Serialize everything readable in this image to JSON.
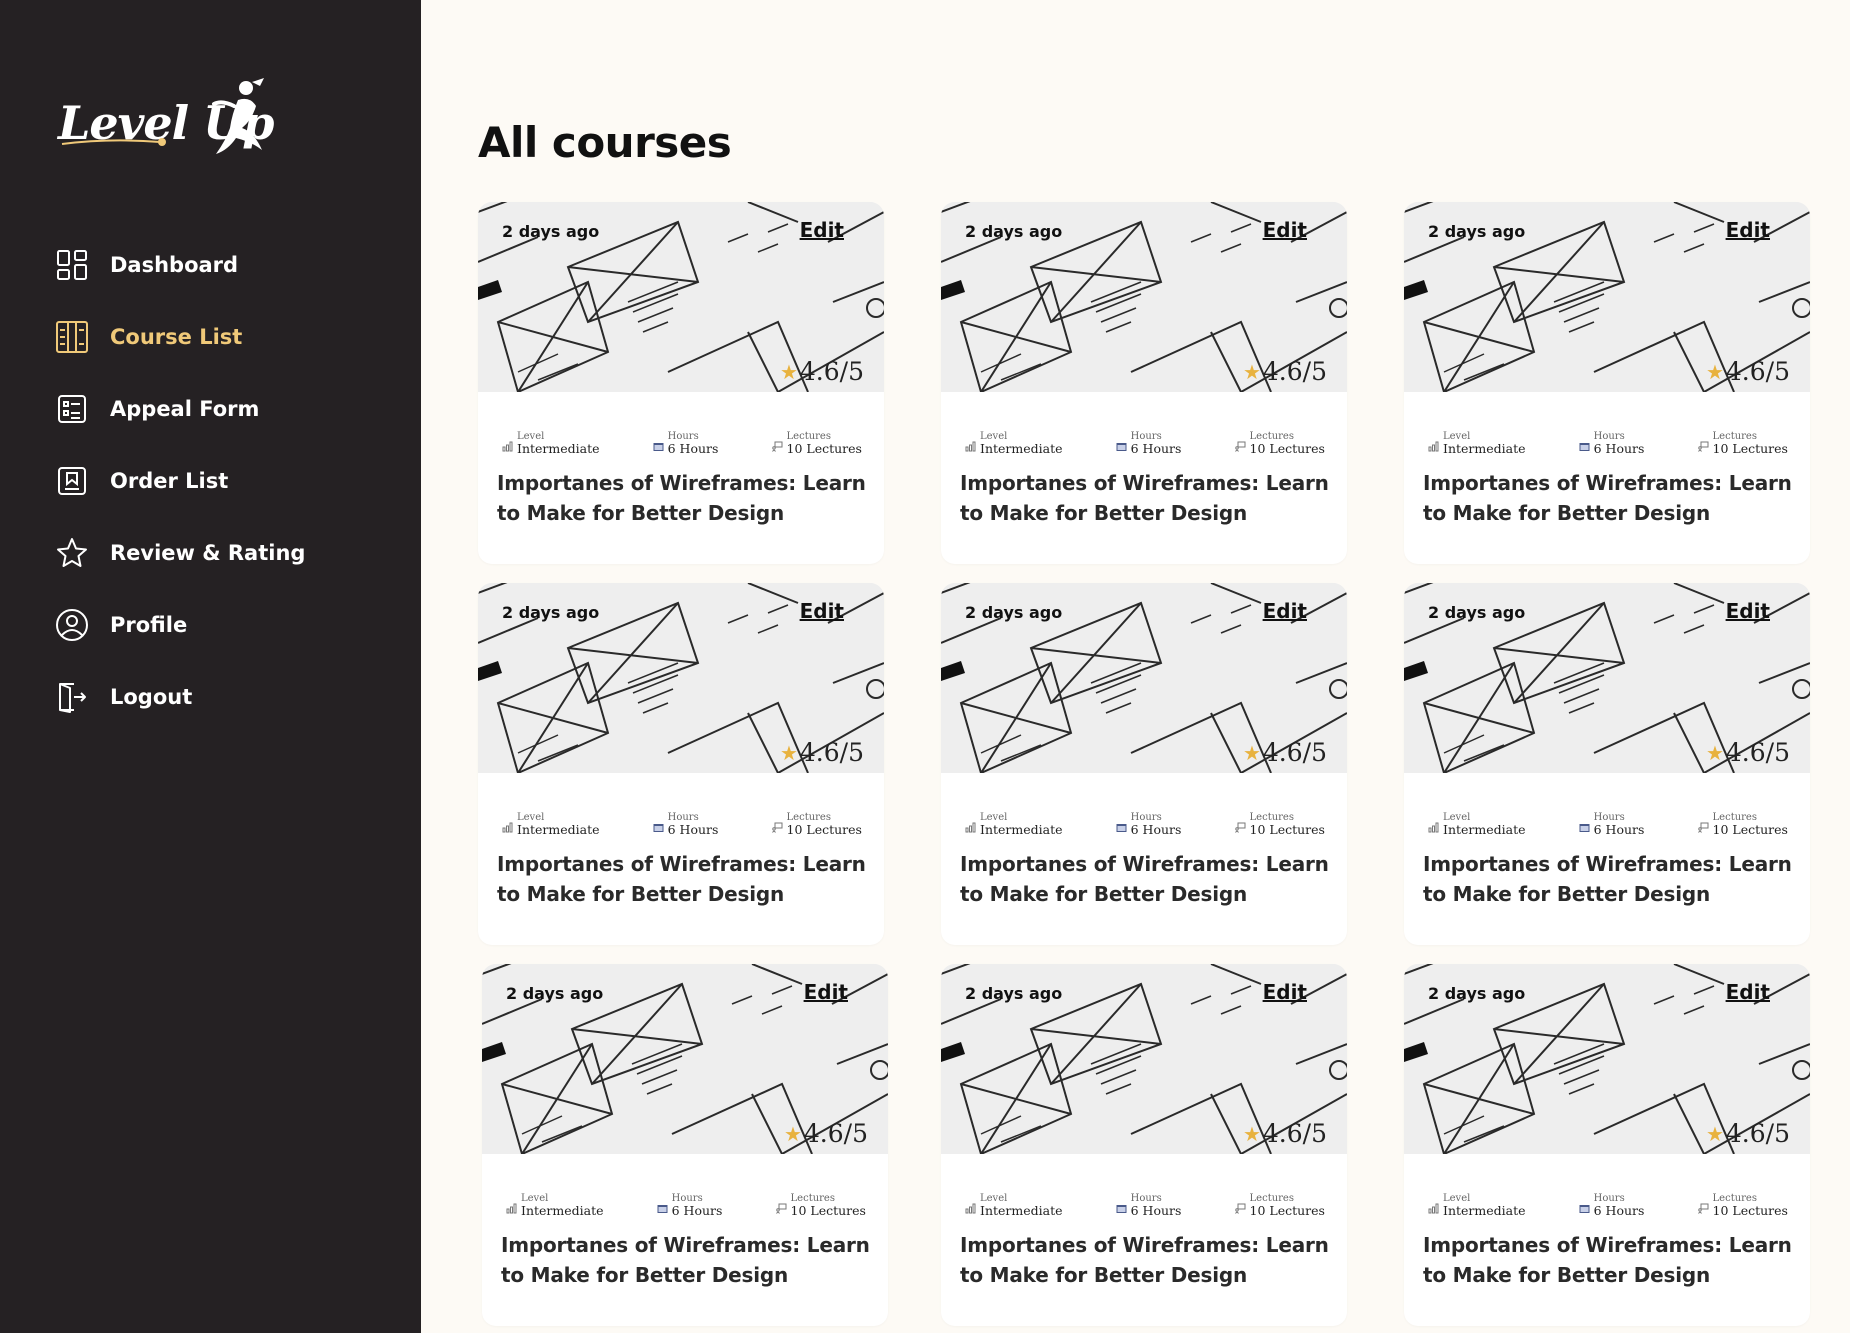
{
  "brand": {
    "name": "Level Up",
    "accent": "#f0c979",
    "sidebar_bg": "#252123",
    "star_color": "#e8b23e"
  },
  "sidebar": {
    "items": [
      {
        "label": "Dashboard",
        "icon": "dashboard-grid-icon"
      },
      {
        "label": "Course List",
        "icon": "course-list-icon",
        "active": true
      },
      {
        "label": "Appeal Form",
        "icon": "form-icon"
      },
      {
        "label": "Order List",
        "icon": "bookmark-icon"
      },
      {
        "label": "Review & Rating",
        "icon": "star-icon"
      },
      {
        "label": "Profile",
        "icon": "user-circle-icon"
      },
      {
        "label": "Logout",
        "icon": "logout-icon"
      }
    ]
  },
  "main": {
    "title": "All courses",
    "courses": [
      {
        "time": "2 days ago",
        "edit": "Edit",
        "rating": "4.6/5",
        "level_label": "Level",
        "level": "Intermediate",
        "hours_label": "Hours",
        "hours": "6 Hours",
        "lectures_label": "Lectures",
        "lectures": "10 Lectures",
        "title": "Importanes of Wireframes: Learn to Make for Better Design"
      },
      {
        "time": "2 days ago",
        "edit": "Edit",
        "rating": "4.6/5",
        "level_label": "Level",
        "level": "Intermediate",
        "hours_label": "Hours",
        "hours": "6 Hours",
        "lectures_label": "Lectures",
        "lectures": "10 Lectures",
        "title": "Importanes of Wireframes: Learn to Make for Better Design"
      },
      {
        "time": "2 days ago",
        "edit": "Edit",
        "rating": "4.6/5",
        "level_label": "Level",
        "level": "Intermediate",
        "hours_label": "Hours",
        "hours": "6 Hours",
        "lectures_label": "Lectures",
        "lectures": "10 Lectures",
        "title": "Importanes of Wireframes: Learn to Make for Better Design"
      },
      {
        "time": "2 days ago",
        "edit": "Edit",
        "rating": "4.6/5",
        "level_label": "Level",
        "level": "Intermediate",
        "hours_label": "Hours",
        "hours": "6 Hours",
        "lectures_label": "Lectures",
        "lectures": "10 Lectures",
        "title": "Importanes of Wireframes: Learn to Make for Better Design"
      },
      {
        "time": "2 days ago",
        "edit": "Edit",
        "rating": "4.6/5",
        "level_label": "Level",
        "level": "Intermediate",
        "hours_label": "Hours",
        "hours": "6 Hours",
        "lectures_label": "Lectures",
        "lectures": "10 Lectures",
        "title": "Importanes of Wireframes: Learn to Make for Better Design"
      },
      {
        "time": "2 days ago",
        "edit": "Edit",
        "rating": "4.6/5",
        "level_label": "Level",
        "level": "Intermediate",
        "hours_label": "Hours",
        "hours": "6 Hours",
        "lectures_label": "Lectures",
        "lectures": "10 Lectures",
        "title": "Importanes of Wireframes: Learn to Make for Better Design"
      },
      {
        "time": "2 days ago",
        "edit": "Edit",
        "rating": "4.6/5",
        "level_label": "Level",
        "level": "Intermediate",
        "hours_label": "Hours",
        "hours": "6 Hours",
        "lectures_label": "Lectures",
        "lectures": "10 Lectures",
        "title": "Importanes of Wireframes: Learn to Make for Better Design"
      },
      {
        "time": "2 days ago",
        "edit": "Edit",
        "rating": "4.6/5",
        "level_label": "Level",
        "level": "Intermediate",
        "hours_label": "Hours",
        "hours": "6 Hours",
        "lectures_label": "Lectures",
        "lectures": "10 Lectures",
        "title": "Importanes of Wireframes: Learn to Make for Better Design"
      },
      {
        "time": "2 days ago",
        "edit": "Edit",
        "rating": "4.6/5",
        "level_label": "Level",
        "level": "Intermediate",
        "hours_label": "Hours",
        "hours": "6 Hours",
        "lectures_label": "Lectures",
        "lectures": "10 Lectures",
        "title": "Importanes of Wireframes: Learn to Make for Better Design"
      }
    ]
  }
}
